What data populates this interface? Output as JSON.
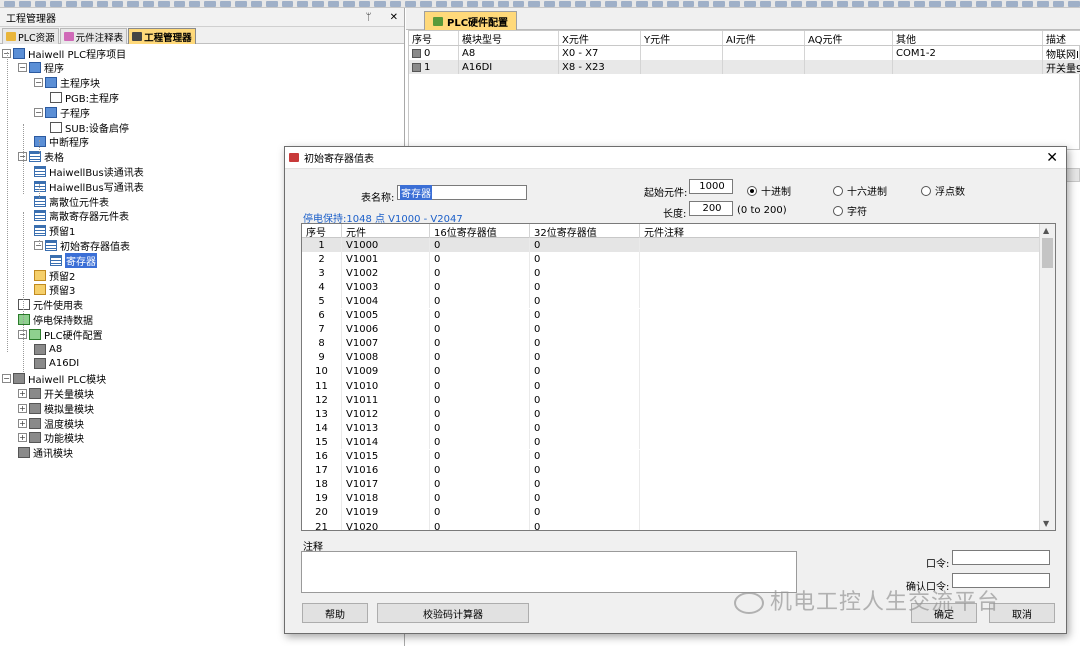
{
  "left_pane": {
    "title": "工程管理器",
    "pin": "ᛘ",
    "close": "✕",
    "tabs": [
      {
        "label": "PLC资源",
        "active": false
      },
      {
        "label": "元件注释表",
        "active": false
      },
      {
        "label": "工程管理器",
        "active": true
      }
    ],
    "tree": [
      "Haiwell PLC程序项目",
      "程序",
      "主程序块",
      "PGB:主程序",
      "子程序",
      "SUB:设备启停",
      "中断程序",
      "表格",
      "HaiwellBus读通讯表",
      "HaiwellBus写通讯表",
      "离散位元件表",
      "离散寄存器元件表",
      "预留1",
      "初始寄存器值表",
      "寄存器",
      "预留2",
      "预留3",
      "元件使用表",
      "停电保持数据",
      "PLC硬件配置",
      "A8",
      "A16DI",
      "Haiwell PLC模块",
      "开关量模块",
      "模拟量模块",
      "温度模块",
      "功能模块",
      "通讯模块"
    ]
  },
  "hardware": {
    "tab_label": "PLC硬件配置",
    "columns": [
      "序号",
      "模块型号",
      "X元件",
      "Y元件",
      "AI元件",
      "AQ元件",
      "其他",
      "描述"
    ],
    "rows": [
      [
        "0",
        "A8",
        "X0 - X7",
        "",
        "",
        "",
        "COM1-2",
        "物联网I"
      ],
      [
        "1",
        "A16DI",
        "X8 - X23",
        "",
        "",
        "",
        "",
        "开关量9"
      ]
    ]
  },
  "dialog": {
    "title": "初始寄存器值表",
    "close": "✕",
    "table_name_label": "表名称:",
    "table_name_value": "寄存器",
    "start_label": "起始元件:",
    "start_value": "1000",
    "length_label": "长度:",
    "length_value": "200",
    "length_range": "(0 to 200)",
    "radio_options": [
      {
        "label": "十进制",
        "selected": true
      },
      {
        "label": "十六进制",
        "selected": false
      },
      {
        "label": "浮点数",
        "selected": false
      },
      {
        "label": "字符",
        "selected": false
      }
    ],
    "retention_text": "停电保持:1048 点 V1000 - V2047",
    "table_columns": [
      "序号",
      "元件",
      "16位寄存器值",
      "32位寄存器值",
      "元件注释"
    ],
    "table_rows": [
      [
        "1",
        "V1000",
        "0",
        "0"
      ],
      [
        "2",
        "V1001",
        "0",
        "0"
      ],
      [
        "3",
        "V1002",
        "0",
        "0"
      ],
      [
        "4",
        "V1003",
        "0",
        "0"
      ],
      [
        "5",
        "V1004",
        "0",
        "0"
      ],
      [
        "6",
        "V1005",
        "0",
        "0"
      ],
      [
        "7",
        "V1006",
        "0",
        "0"
      ],
      [
        "8",
        "V1007",
        "0",
        "0"
      ],
      [
        "9",
        "V1008",
        "0",
        "0"
      ],
      [
        "10",
        "V1009",
        "0",
        "0"
      ],
      [
        "11",
        "V1010",
        "0",
        "0"
      ],
      [
        "12",
        "V1011",
        "0",
        "0"
      ],
      [
        "13",
        "V1012",
        "0",
        "0"
      ],
      [
        "14",
        "V1013",
        "0",
        "0"
      ],
      [
        "15",
        "V1014",
        "0",
        "0"
      ],
      [
        "16",
        "V1015",
        "0",
        "0"
      ],
      [
        "17",
        "V1016",
        "0",
        "0"
      ],
      [
        "18",
        "V1017",
        "0",
        "0"
      ],
      [
        "19",
        "V1018",
        "0",
        "0"
      ],
      [
        "20",
        "V1019",
        "0",
        "0"
      ],
      [
        "21",
        "V1020",
        "0",
        "0"
      ]
    ],
    "note_label": "注释",
    "password_label": "口令:",
    "confirm_password_label": "确认口令:",
    "buttons": {
      "help": "帮助",
      "checksum": "校验码计算器",
      "ok": "确定",
      "cancel": "取消"
    }
  },
  "watermark": "机电工控人生交流平台"
}
